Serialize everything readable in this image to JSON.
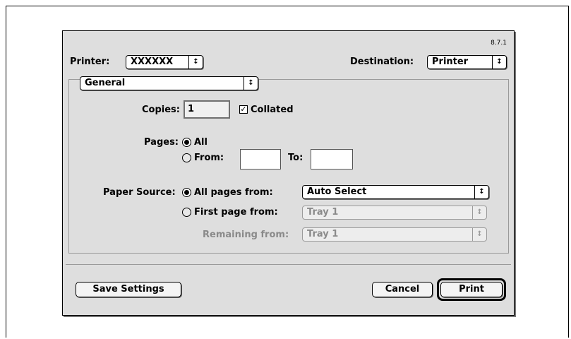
{
  "version": "8.7.1",
  "printer": {
    "label": "Printer:",
    "value": "XXXXXX"
  },
  "destination": {
    "label": "Destination:",
    "value": "Printer"
  },
  "panel": {
    "value": "General"
  },
  "copies": {
    "label": "Copies:",
    "value": "1",
    "collated_label": "Collated",
    "collated": true
  },
  "pages": {
    "label": "Pages:",
    "all_label": "All",
    "from_label": "From:",
    "from_value": "",
    "to_label": "To:",
    "to_value": "",
    "selected": "All"
  },
  "paper_source": {
    "label": "Paper Source:",
    "all_pages_label": "All pages from:",
    "all_pages_value": "Auto Select",
    "first_page_label": "First page from:",
    "first_page_value": "Tray 1",
    "remaining_label": "Remaining from:",
    "remaining_value": "Tray 1",
    "selected": "All pages from:"
  },
  "buttons": {
    "save": "Save Settings",
    "cancel": "Cancel",
    "print": "Print"
  },
  "icons": {
    "popup_arrow": "up-down-arrows-icon"
  }
}
